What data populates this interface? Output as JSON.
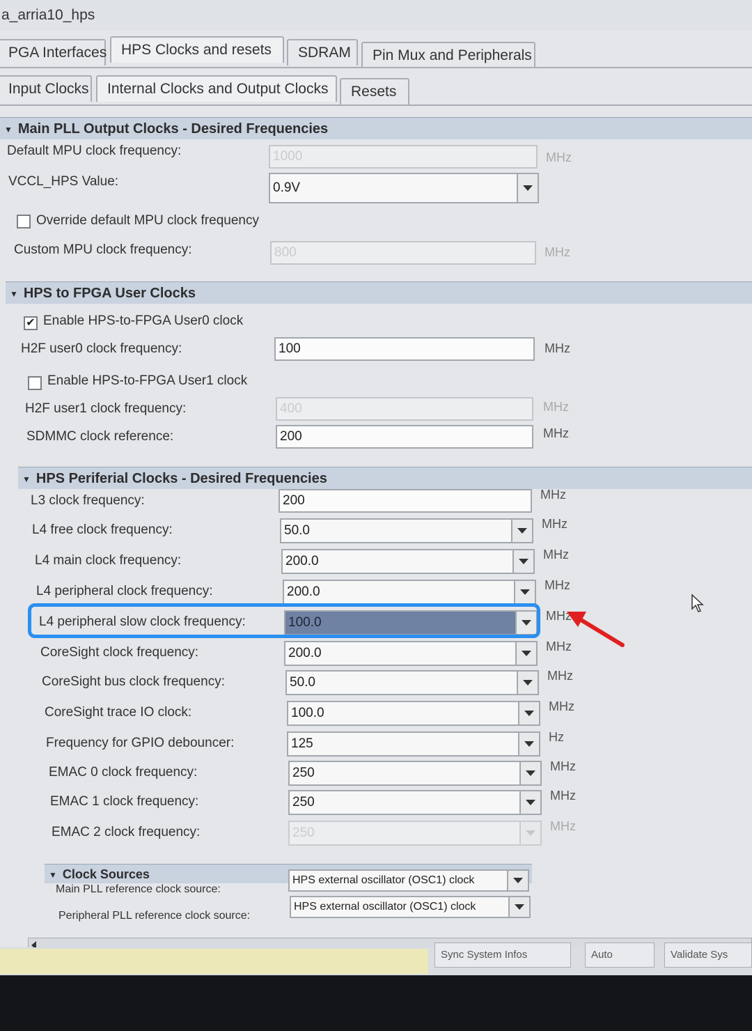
{
  "window_title": "a_arria10_hps",
  "top_tabs": [
    "PGA Interfaces",
    "HPS Clocks and resets",
    "SDRAM",
    "Pin Mux and Peripherals"
  ],
  "sub_tabs": [
    "Input Clocks",
    "Internal Clocks and Output Clocks",
    "Resets"
  ],
  "main_pll": {
    "header": "Main PLL Output Clocks - Desired Frequencies",
    "default_mpu_label": "Default MPU clock frequency:",
    "default_mpu_value": "1000",
    "vccl_label": "VCCL_HPS Value:",
    "vccl_value": "0.9V",
    "override_label": "Override default MPU clock frequency",
    "custom_mpu_label": "Custom MPU clock frequency:",
    "custom_mpu_value": "800"
  },
  "user_clocks": {
    "header": "HPS to FPGA User Clocks",
    "enable0_label": "Enable HPS-to-FPGA User0 clock",
    "user0_label": "H2F user0 clock frequency:",
    "user0_value": "100",
    "enable1_label": "Enable HPS-to-FPGA User1 clock",
    "user1_label": "H2F user1 clock frequency:",
    "user1_value": "400",
    "sdmmc_label": "SDMMC clock reference:",
    "sdmmc_value": "200"
  },
  "peripheral": {
    "header": "HPS Periferial Clocks - Desired Frequencies",
    "rows": [
      {
        "label": "L3 clock frequency:",
        "value": "200",
        "unit": "MHz"
      },
      {
        "label": "L4 free clock frequency:",
        "value": "50.0",
        "unit": "MHz"
      },
      {
        "label": "L4 main clock frequency:",
        "value": "200.0",
        "unit": "MHz"
      },
      {
        "label": "L4 peripheral clock frequency:",
        "value": "200.0",
        "unit": "MHz"
      },
      {
        "label": "L4 peripheral slow clock frequency:",
        "value": "100.0",
        "unit": "MHz"
      },
      {
        "label": "CoreSight clock frequency:",
        "value": "200.0",
        "unit": "MHz"
      },
      {
        "label": "CoreSight bus clock frequency:",
        "value": "50.0",
        "unit": "MHz"
      },
      {
        "label": "CoreSight trace IO clock:",
        "value": "100.0",
        "unit": "MHz"
      },
      {
        "label": "Frequency for GPIO debouncer:",
        "value": "125",
        "unit": "Hz"
      },
      {
        "label": "EMAC 0 clock frequency:",
        "value": "250",
        "unit": "MHz"
      },
      {
        "label": "EMAC 1 clock frequency:",
        "value": "250",
        "unit": "MHz"
      },
      {
        "label": "EMAC 2 clock frequency:",
        "value": "250",
        "unit": "MHz"
      }
    ]
  },
  "clock_sources": {
    "header": "Clock Sources",
    "main_label": "Main PLL reference clock source:",
    "main_value": "HPS external oscillator (OSC1) clock",
    "periph_label": "Peripheral PLL reference clock source:",
    "periph_value": "HPS external oscillator (OSC1) clock"
  },
  "units": {
    "mhz": "MHz"
  },
  "status_buttons": [
    "Sync System Infos",
    "Auto",
    "Validate Sys"
  ],
  "colors": {
    "highlight": "#2a8ff0",
    "arrow": "#e02020",
    "section_header": "#c9d2df"
  }
}
